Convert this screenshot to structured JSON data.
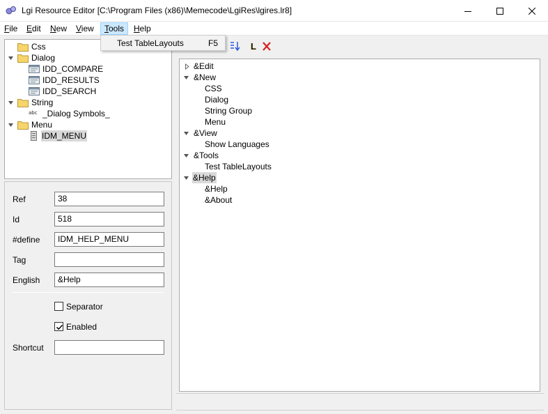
{
  "window": {
    "title": "Lgi Resource Editor [C:\\Program Files (x86)\\Memecode\\LgiRes\\lgires.lr8]"
  },
  "menubar": {
    "items": [
      {
        "label": "File",
        "accel": "F",
        "rest": "ile"
      },
      {
        "label": "Edit",
        "accel": "E",
        "rest": "dit"
      },
      {
        "label": "New",
        "accel": "N",
        "rest": "ew"
      },
      {
        "label": "View",
        "accel": "V",
        "rest": "iew"
      },
      {
        "label": "Tools",
        "accel": "T",
        "rest": "ools"
      },
      {
        "label": "Help",
        "accel": "H",
        "rest": "elp"
      }
    ]
  },
  "tools_menu": {
    "items": [
      {
        "label": "Test TableLayouts",
        "shortcut": "F5"
      }
    ]
  },
  "resource_tree": {
    "nodes": [
      {
        "label": "Css",
        "icon": "folder-icon",
        "level": 0,
        "expander": "none"
      },
      {
        "label": "Dialog",
        "icon": "folder-icon",
        "level": 0,
        "expander": "expanded"
      },
      {
        "label": "IDD_COMPARE",
        "icon": "dialog-icon",
        "level": 1
      },
      {
        "label": "IDD_RESULTS",
        "icon": "dialog-icon",
        "level": 1
      },
      {
        "label": "IDD_SEARCH",
        "icon": "dialog-icon",
        "level": 1
      },
      {
        "label": "String",
        "icon": "folder-icon",
        "level": 0,
        "expander": "expanded"
      },
      {
        "label": "_Dialog Symbols_",
        "icon": "abc-icon",
        "level": 1
      },
      {
        "label": "Menu",
        "icon": "folder-icon",
        "level": 0,
        "expander": "expanded"
      },
      {
        "label": "IDM_MENU",
        "icon": "menu-resource-icon",
        "level": 1,
        "selected": true
      }
    ]
  },
  "properties": {
    "ref": {
      "label": "Ref",
      "value": "38"
    },
    "id": {
      "label": "Id",
      "value": "518"
    },
    "define": {
      "label": "#define",
      "value": "IDM_HELP_MENU"
    },
    "tag": {
      "label": "Tag",
      "value": ""
    },
    "english": {
      "label": "English",
      "value": "&Help"
    },
    "separator": {
      "label": "Separator",
      "checked": false
    },
    "enabled": {
      "label": "Enabled",
      "checked": true
    },
    "shortcut": {
      "label": "Shortcut",
      "value": ""
    }
  },
  "toolbar": {
    "icons": [
      "sort-icon",
      "l-icon",
      "delete-icon"
    ],
    "l_label": "L"
  },
  "menu_tree": {
    "nodes": [
      {
        "label": "&Edit",
        "level": 0,
        "expander": "collapsed"
      },
      {
        "label": "&New",
        "level": 0,
        "expander": "expanded"
      },
      {
        "label": "CSS",
        "level": 1
      },
      {
        "label": "Dialog",
        "level": 1
      },
      {
        "label": "String Group",
        "level": 1
      },
      {
        "label": "Menu",
        "level": 1
      },
      {
        "label": "&View",
        "level": 0,
        "expander": "expanded"
      },
      {
        "label": "Show Languages",
        "level": 1
      },
      {
        "label": "&Tools",
        "level": 0,
        "expander": "expanded"
      },
      {
        "label": "Test TableLayouts",
        "level": 1
      },
      {
        "label": "&Help",
        "level": 0,
        "expander": "expanded",
        "selected": true
      },
      {
        "label": "&Help",
        "level": 1
      },
      {
        "label": "&About",
        "level": 1
      }
    ]
  },
  "colors": {
    "menu_active_bg": "#cce8ff",
    "selection_bg": "#d9d9d9",
    "folder_yellow": "#f7d56b"
  }
}
